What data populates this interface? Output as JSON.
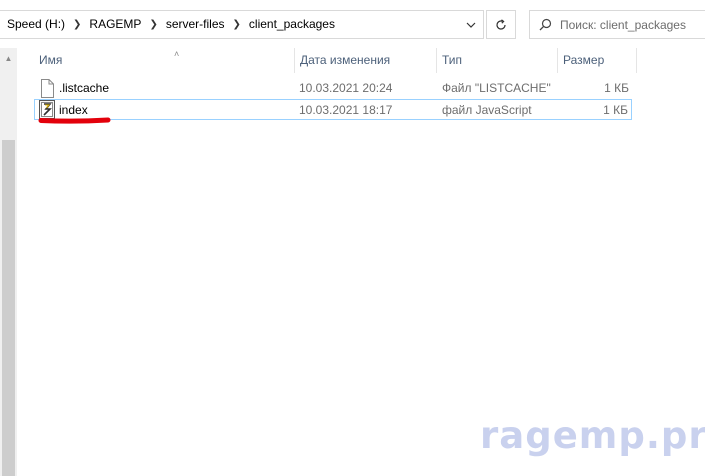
{
  "address_bar": {
    "breadcrumbs": [
      "Speed (H:)",
      "RAGEMP",
      "server-files",
      "client_packages"
    ],
    "dropdown_icon": "chevron-down-icon",
    "refresh_icon": "refresh-icon"
  },
  "search": {
    "placeholder": "Поиск: client_packages",
    "icon": "search-icon"
  },
  "columns": {
    "name": "Имя",
    "date": "Дата изменения",
    "type": "Тип",
    "size": "Размер"
  },
  "files": [
    {
      "name": ".listcache",
      "date": "10.03.2021 20:24",
      "type": "Файл \"LISTCACHE\"",
      "size": "1 КБ",
      "icon": "generic-file-icon",
      "selected": false
    },
    {
      "name": "index",
      "date": "10.03.2021 18:17",
      "type": "файл JavaScript",
      "size": "1 КБ",
      "icon": "javascript-file-icon",
      "selected": true
    }
  ],
  "annotation": {
    "color": "#e3000b"
  },
  "watermark": {
    "text": "ragemp.pro"
  },
  "colors": {
    "header_text": "#4c607a",
    "selection_border": "#99d1ff",
    "detail_text": "#6d6d6d"
  }
}
